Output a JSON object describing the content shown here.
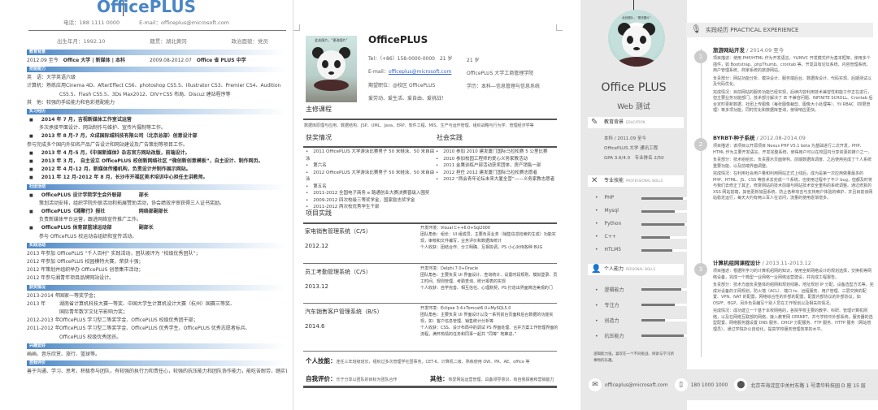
{
  "resume1": {
    "title": "OfficePLUS",
    "phone": "电话：188 1111 0000",
    "email": "E-mail：officeplus@microsoft.com",
    "birth": "出生年月：1992.10",
    "native": "籍贯：湖北黄冈",
    "political": "政治面貌：党员",
    "sections": {
      "education": "教育背景",
      "skills": "技能能力",
      "internship": "实习经历",
      "campus": "社团活动",
      "practice": "实践活动",
      "awards": "获奖情况",
      "hobbies": "兴趣爱好",
      "self": "自我评价"
    },
    "edu": [
      {
        "date": "2012.09 至今",
        "school": "Office 大学 | 新媒体 | 本科"
      },
      {
        "date": "2009.08-2012.07",
        "school": "Office 省 PLUS 中学"
      }
    ],
    "skill_lines": [
      "英　语：大学英语六级",
      "计算机：熟练应用Cinema 4D、AfterEffect CS6、photoshop CS5.5、Illustrator CS3、Premier CS4、Audition",
      "CS5.5、Flash CS5.5、3Ds Max2012、DIV+CSS 布局、Discuz 建站程序等",
      "其　他：较强的手绘能力和色彩搭配能力"
    ],
    "intern": [
      {
        "title": "2014 年 7 月，吉视新媒体工作室试运营",
        "desc": "多次承接平面设计、网站制作与维护、宣传片摄制等工作。"
      },
      {
        "title": "2013 年 8 月-7 月，众成国际城科技有限公司（北京总部）创意设计部",
        "desc": "参与完成多个国内外知名产品广告设计和网站建设及广告策划等项目工作。"
      },
      {
        "title": "2013 年 4 月-5 月，《中国新媒体》杂志官方网站改版，前端设计。",
        "desc": ""
      },
      {
        "title": "2013 年 3 月，　自主设立 OfficePLUS 校创新网络社区 “微创新创意模板”，自主设计、制作网页。",
        "desc": ""
      },
      {
        "title": "2012 年 4 月-12 月，新媒体传播机构，负责设计并制作展示网站。",
        "desc": ""
      },
      {
        "title": "2011 年 12 月-2012 年 8 月，长沙市开福区美术培训中心担任主讲教师。",
        "desc": ""
      }
    ],
    "campus": [
      {
        "org": "OfficePLUS 设计学院学生会外联部",
        "role": "部长",
        "desc": "策划活动安排，组织学院外联活动和拓展赞助活动，协会绩效评审获得三人证书奖励。"
      },
      {
        "org": "OfficePLUS《湘聚行》报社",
        "role": "网络部副部长",
        "desc": "负责新媒体平台运营，跟进网络宣传推广工作。"
      },
      {
        "org": "OfficePLUS 体育部篮球运动部",
        "role": "副部长",
        "desc": "参与 OfficePLUS 校运动会组织和宣传活动。"
      }
    ],
    "practice": [
      "2013 年参加 OfficePLUS “千人百村” 实践活动，团队被评为 “校级优秀团队”；",
      "2012 年参加 OfficePLUS 校园模特大赛，荣获十强；",
      "2012 年策划并组织举办 OfficePLUS 创意集市活动；",
      "2012 年参与湘青年项目品牌网站设计。"
    ],
    "awards": [
      {
        "year": "2013-2014 年",
        "text": "国家一等奖学金；"
      },
      {
        "year": "2013 年",
        "text": "湖南省计算机科技大赛一等奖、中国大学生计算机设计大赛（杭州）国赛三等奖、"
      },
      {
        "year": "",
        "text": "国际青年数字文化节影响力奖；"
      },
      {
        "year": "2012-2013 年",
        "text": "OfficePLUS 学习型二等奖学金、OfficePLUS 校级优秀团干部；"
      },
      {
        "year": "2011-2012 年",
        "text": "OfficePLUS 学习型二等奖学金、OfficePLUS 优秀学生、OfficePLUS 优秀志愿者标兵、"
      },
      {
        "year": "",
        "text": "OfficePLUS 校级优秀团员。"
      }
    ],
    "hobbies": "画画、音乐欣赏、旅行、篮球等。",
    "self": "善于沟通、学习、思考，积极参与团队，有较强的执行力和责任心，较强的抗压能力和团队协作能力，能吃苦耐劳，踏实肯干，诚实守信等等"
  },
  "resume2": {
    "photo_caption": "此处图片，“更改图片”",
    "name": "OfficePLUS",
    "tel": "Tel：（+86）158-0000-0000　21 岁",
    "email_label": "E-mail：",
    "email": "officeplus@microsoft.com",
    "job": "期望职位：@校区 OfficePLUS",
    "motto": "爱劳动、爱生活、爱自由、爱挑战！",
    "age": "21 岁",
    "school": "OfficePLUS 大学工商管理学院",
    "degree": "学历：本科—信息管理与信息系统",
    "courses_h": "主修课程",
    "courses": "数据库原理与应用、数据结构、JSP、UML、Java、ERP、软件工程、MIS、生产与运作管理、组织战略与行为学、管理经济学等",
    "awards_h": "获奖情况",
    "awards": [
      "2011 OfficePLUS 大学游泳比赛男子 50 米蛙泳、50 米自由泳",
      "第六名",
      "2012 OfficePLUS 大学游泳比赛男子 50 米蛙泳、50 米自由泳",
      "第五名",
      "2011-2012 全国电子商务 e 路通创业大赛决赛晋级入围奖",
      "2009-2012 四次校级三等奖学金，国家励志奖学金",
      "2011-2012 两次校优秀学生干部"
    ],
    "social_h": "社会实践",
    "social": [
      "2010 参加 2010 建发厦门国际马拉松赛 5 公里比赛",
      "2010 参加校园工程师的爱心义务家教活动",
      "2011 金鹰训练户部活动获奖团体，房产销售一部",
      "2012 担任 2012 建发厦门国际马拉松赛志愿者",
      "2012 “两会青年论坛未来大厦全营”——义务家教志愿者"
    ],
    "proj_h": "项目实践",
    "projects": [
      {
        "name": "家电销售管理系统（C/S）",
        "date": "2012.12",
        "lines": [
          "开发环境：Visual C++6.0+Sql2000",
          "团队角色：组长：UI 组成员，主要负责业务（销售信息检索的生成）功能实现，审核和文件编写，业务评价和数据库统计",
          "个人收获：团结合作、分工明确、互相协调，PS 小心对待各种 BUG"
        ]
      },
      {
        "name": "员工考勤管理系统（C/S）",
        "date": "2013.12",
        "lines": [
          "开发环境：Delphi 7.0+Oracle",
          "团队角色：主要负责 UI 界面设计、查询统计、设置时段规则、模拟登录、员工时间、规则管理、考勤查询、统计报表的实现",
          "个人收获：自学完善、相互信任、心理默契，PS 打造出界面简洁美观的门"
        ]
      },
      {
        "name": "汽车销售客户管理系统（B/S）",
        "date": "2014.6",
        "lines": [
          "开发环境：Eclipse 3.4+Tomcat6.0+MySQL5.0",
          "团队角色：主要负责 UI 界面设计以及一系列前台页面和后台数据的功能实现，如：客户信息管理、销售统计分析等",
          "个人收获：CSS、设计布局中的调试 PS 界面处理、合并方案工作管理界面的流程，满怀热情的任务和同事一起共 “同等” 地推进、”"
        ]
      }
    ],
    "skills_h": "个人技能：",
    "skills": "连任三年班级班长，组织过多次管理学社团事务，CET-6、计算机二级，熟练使用 DW、PR、AE、office 等",
    "eval_h": "自我评价：",
    "eval": "乐于分享以团队的目标为团队合作",
    "other_h": "其他：",
    "other": "热爱网站运营管理、具备领导意识、有自我探索和营销能力"
  },
  "resume3": {
    "avatar_caption": "此处图片，“更改图片”",
    "name": "Office PLUS",
    "subtitle": "Web 测试",
    "edu_h": "教育背景",
    "edu_en": "EDUCATION",
    "edu_lines": [
      "本科 / 2011.09 至今",
      "OfficePLUS 大学 通讯工程",
      "GPA 3.6/4.0　专业排名 2/50"
    ],
    "skills_h": "专业技能",
    "skills_en": "PROFESSIONAL SKILLS",
    "skills": [
      {
        "name": "PHP",
        "level": 0.88
      },
      {
        "name": "Mysql",
        "level": 0.7
      },
      {
        "name": "Python",
        "level": 0.92
      },
      {
        "name": "C++",
        "level": 0.6
      },
      {
        "name": "HTLM5",
        "level": 0.65
      }
    ],
    "personal_h": "个人能力",
    "personal_en": "PERSONAL SKILLS",
    "personal": [
      {
        "name": "逻辑能力",
        "level": 0.85
      },
      {
        "name": "专注力",
        "level": 0.7
      },
      {
        "name": "创造力",
        "level": 0.5
      },
      {
        "name": "抗压能力",
        "level": 0.9
      }
    ],
    "personal_note": [
      "逻辑能力强，喜欢在一个不同挑战、探索与学习新",
      "事物的乐趣。"
    ],
    "exp_h": "实践经历 PRACTICAL EXPERIENCE",
    "experiences": [
      {
        "num": "1",
        "title": "旅游网站开发",
        "date": " / 2014.09 至今",
        "paras": [
          "项目描述：使用 PHP/HTML 作为开发语言，Yii/MVC 开发模式作为基本框架，使用多个插件，如 Bootstrap、phpThumb、crontab 等，开发具有论坛系统、内容管理系统、用户管理系统、商家系统的旅游网站。",
          "负责部分：网站功能分析、模块设计、服务端后台、数据库设计、代码实现、后期测试以及代码优化。",
          "完成情况：目前网站的服务功能已经实现，后续内容利用技术兼容性和能工作正在进行，但主要业务功能部门，技术部分解决了 IE 不兼容问题、INFINITE SCROLL、Crontab 后台定时更新数据、社团上传图像（每张图像裁剪、图像大小处理等）、Yii RBAC（权限管理）等多项功能，同时优化和数据库查询，使得响应更快。"
        ]
      },
      {
        "num": "2",
        "title": "BYRBT-种子系统",
        "date": " / 2012.08-2014.09",
        "paras": [
          "项目描述：该项目以开源项目 Nexus PHP V5.1 beta 为基础进行二次开发，PHP、HTML 作为主要开发语言，开发完整系统，使得用户可以在校园内分享资源的媒介之一。",
          "负责部分：技术组组长，负责展示页面架构、前端数据库调度、之后使用完成了个人系统重要功能、以及前端界面调整。",
          "完成情况：在利用社会用户量和利用网站正式上线后，成为是第一次应用做量最多的 PHP、HTML、JS、CSS 等技术去完成一个系统，也使用过程中了不少 bug，但都及时将与我们去修正了其正，修复网站的技术前端与网站技术安全重构的系统调整。通过修复的 XSS 网站前端，其他更新加固系统，防止各种攻击与支持用户体验的维护，并且目前该网站稳定运行，每天大约有两三百人在访问，流量的使用逐渐增多。"
        ]
      },
      {
        "num": "3",
        "title": "计算机组网课程设计",
        "date": " / 2013.11-2013.12",
        "paras": [
          "项目描述：根据所学习的计算机组网的知识，使用全新网络设计的规划选择，交换机等网络设备，完成一个典型一业网络一业网络运营建设，并完成工程报告。",
          "负责部分：技术方面负责整体的组网和规划线路，地址规划 IP 分配，设备选型方式等，完成对设备的子网规划，防火墙（ACL）、端口 tv、远程服务、用户管理、三层交换的配置、VPN、NAT 的配置，网络综合性的外部的配置，配置内部协议的外部协议，如 OSPF、BGP，另外负责编写个别人员在工作规划以及相关的情况。",
          "完成情况：成功建立一个基于本校网络的，各院学校主要的教学、科研、管理计算机网络，以及在网络互联部的网络，接入教育网 CERNET，并与学校中外部系统，服务器的选型配置、网络服务器设置 DNS 服务、DHCP 分配服务、FTP 服务、HTTP 服务（网站管理员），通过学院办公自动化，提高学校服务管理效率的水平。"
        ]
      }
    ],
    "footer": {
      "email": "officeplus@microsoft.com",
      "phone": "180 1000 1000",
      "address": "北京市海淀区中关村东路 1 号清华科技园 D 座 15 层"
    }
  },
  "colors": {
    "blue": "#4a86c5",
    "gray": "#e8e8e8"
  }
}
